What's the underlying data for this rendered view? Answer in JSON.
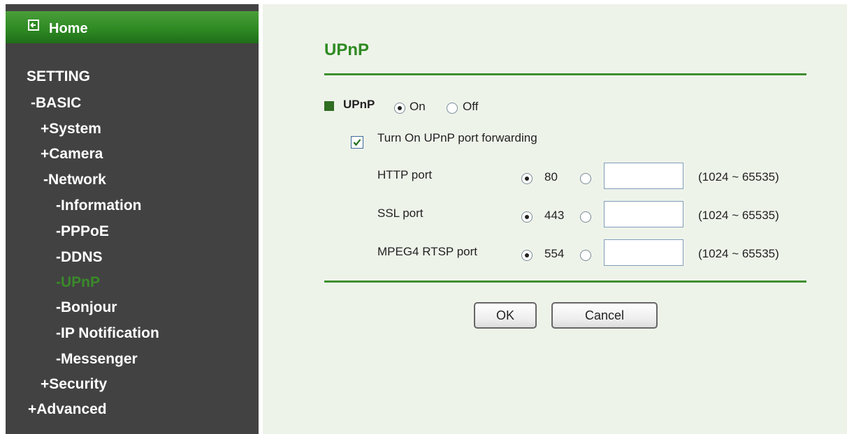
{
  "sidebar": {
    "home_label": "Home",
    "items": [
      {
        "label": "SETTING",
        "active": false
      },
      {
        "label": "-BASIC",
        "active": false
      },
      {
        "label": "+System",
        "active": false
      },
      {
        "label": "+Camera",
        "active": false
      },
      {
        "label": "-Network",
        "active": false
      },
      {
        "label": "-Information",
        "active": false
      },
      {
        "label": "-PPPoE",
        "active": false
      },
      {
        "label": "-DDNS",
        "active": false
      },
      {
        "label": "-UPnP",
        "active": true
      },
      {
        "label": "-Bonjour",
        "active": false
      },
      {
        "label": "-IP Notification",
        "active": false
      },
      {
        "label": "-Messenger",
        "active": false
      },
      {
        "label": "+Security",
        "active": false
      },
      {
        "label": "+Advanced",
        "active": false
      }
    ]
  },
  "main": {
    "title": "UPnP",
    "upnp": {
      "label": "UPnP",
      "on_label": "On",
      "off_label": "Off",
      "selected": "On"
    },
    "forwarding": {
      "label": "Turn On UPnP port forwarding",
      "checked": true
    },
    "ports": [
      {
        "label": "HTTP port",
        "default_value": "80",
        "custom_value": "",
        "range": "(1024 ~ 65535)",
        "selected": "default"
      },
      {
        "label": "SSL port",
        "default_value": "443",
        "custom_value": "",
        "range": "(1024 ~ 65535)",
        "selected": "default"
      },
      {
        "label": "MPEG4 RTSP port",
        "default_value": "554",
        "custom_value": "",
        "range": "(1024 ~ 65535)",
        "selected": "default"
      }
    ],
    "ok_label": "OK",
    "cancel_label": "Cancel"
  },
  "colors": {
    "accent": "#2e8a22",
    "sidebar_bg": "#424242",
    "main_bg": "#eef3ea",
    "active_nav": "#3a8a2a"
  }
}
